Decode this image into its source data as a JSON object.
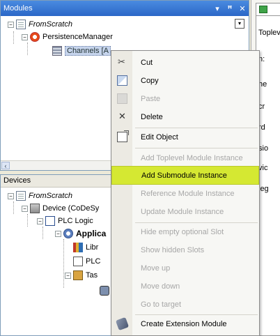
{
  "modules_pane": {
    "title": "Modules",
    "controls": {
      "dropdown": "▾",
      "pin": "ꟸ",
      "close": "✕"
    },
    "tree": {
      "root": "FromScratch",
      "child": "PersistenceManager",
      "grandchild": "Channels [A"
    }
  },
  "right_pane": {
    "tab_label": "Toplev",
    "snippets": [
      "n:",
      "he",
      "cr",
      "rd",
      "sio",
      "vic",
      "leg"
    ]
  },
  "devices_pane": {
    "title": "Devices",
    "tree": {
      "root": "FromScratch",
      "device": "Device (CoDeSy",
      "plc_logic": "PLC Logic",
      "application": "Applica",
      "library": "Libr",
      "plc_prg": "PLC",
      "task": "Tas"
    }
  },
  "context_menu": {
    "items": [
      {
        "label": "Cut",
        "icon": "scissors-icon",
        "enabled": true
      },
      {
        "label": "Copy",
        "icon": "copy-icon",
        "enabled": true
      },
      {
        "label": "Paste",
        "icon": "paste-icon",
        "enabled": false
      },
      {
        "label": "Delete",
        "icon": "delete-icon",
        "enabled": true
      },
      {
        "label": "Edit Object",
        "icon": "edit-object-icon",
        "enabled": true
      },
      {
        "label": "Add Toplevel Module Instance",
        "icon": "",
        "enabled": false
      },
      {
        "label": "Add Submodule Instance",
        "icon": "",
        "enabled": true,
        "highlighted": true
      },
      {
        "label": "Reference Module Instance",
        "icon": "",
        "enabled": false
      },
      {
        "label": "Update Module Instance",
        "icon": "",
        "enabled": false
      },
      {
        "label": "Hide empty optional Slot",
        "icon": "",
        "enabled": false
      },
      {
        "label": "Show hidden Slots",
        "icon": "",
        "enabled": false
      },
      {
        "label": "Move up",
        "icon": "",
        "enabled": false
      },
      {
        "label": "Move down",
        "icon": "",
        "enabled": false
      },
      {
        "label": "Go to target",
        "icon": "",
        "enabled": false
      },
      {
        "label": "Create Extension Module",
        "icon": "extension-module-icon",
        "enabled": true
      }
    ],
    "highlight_color": "#d5e832"
  }
}
